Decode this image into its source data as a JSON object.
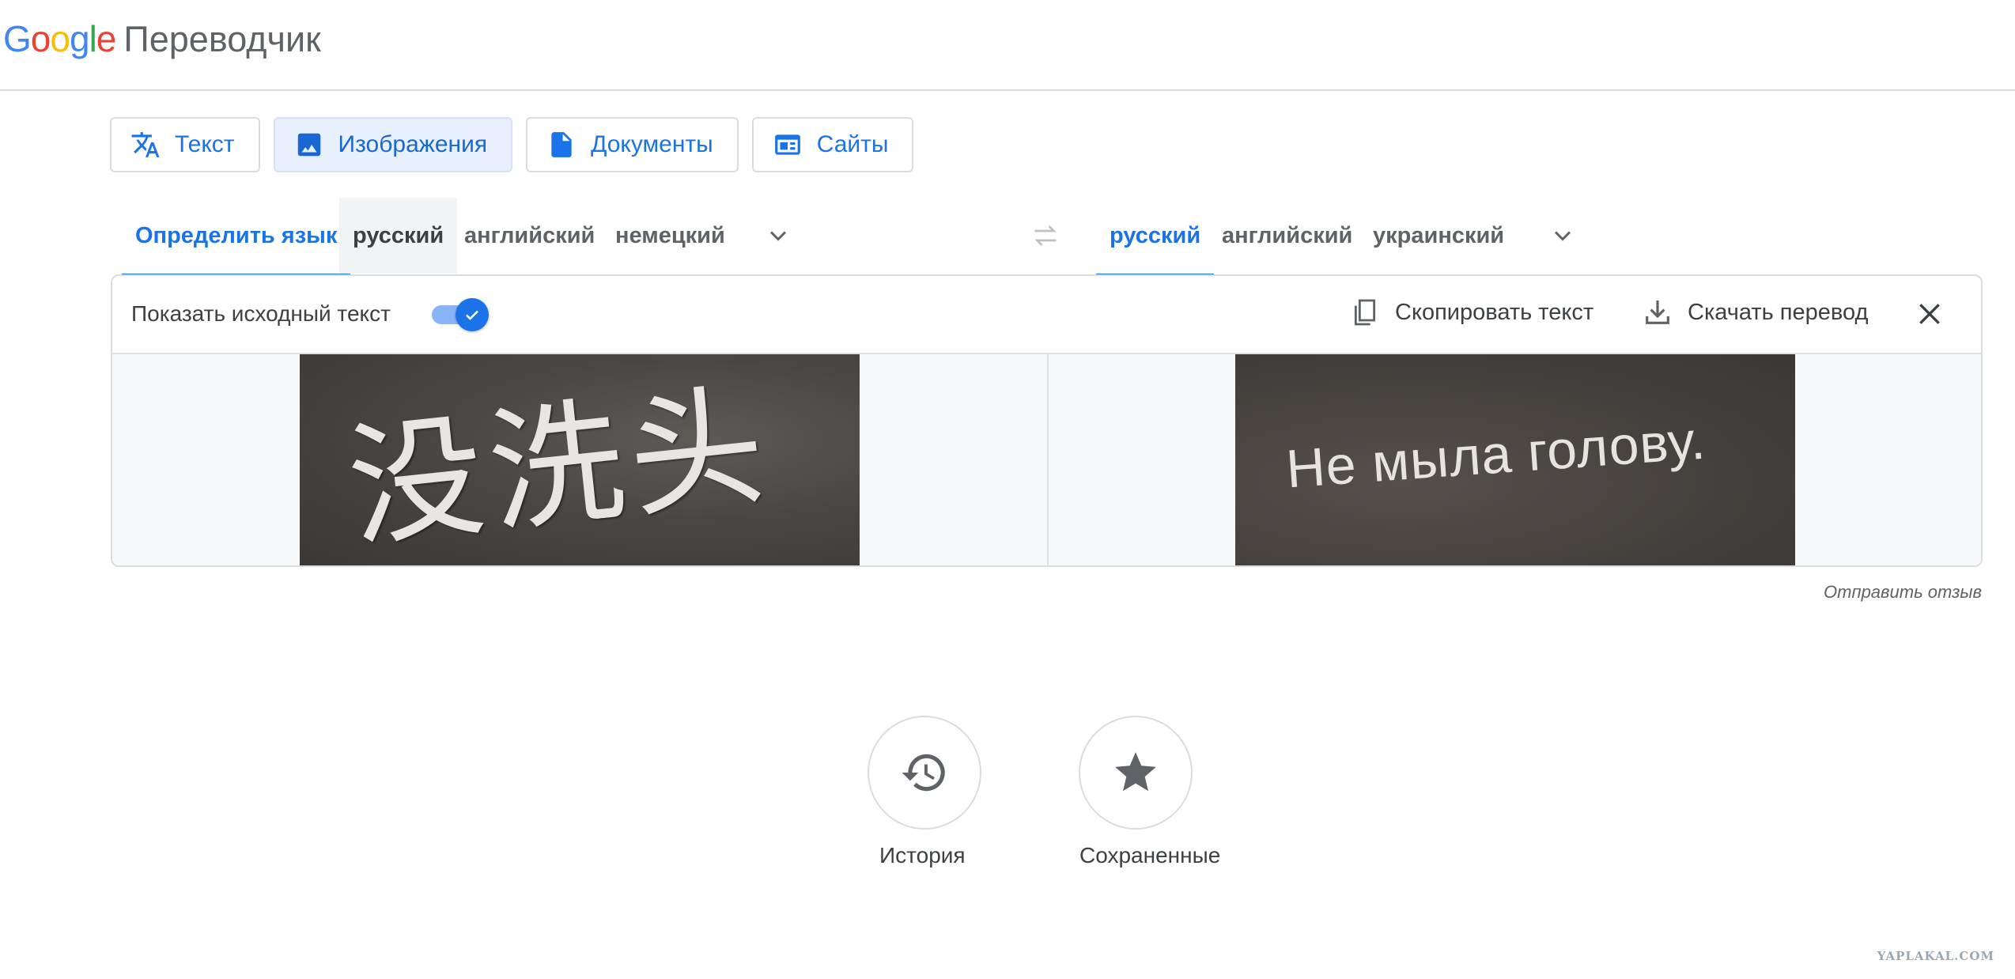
{
  "header": {
    "logo_letters": [
      {
        "char": "G",
        "color": "#4285f4"
      },
      {
        "char": "o",
        "color": "#ea4335"
      },
      {
        "char": "o",
        "color": "#fbbc05"
      },
      {
        "char": "g",
        "color": "#4285f4"
      },
      {
        "char": "l",
        "color": "#34a853"
      },
      {
        "char": "e",
        "color": "#ea4335"
      }
    ],
    "product_name": "Переводчик"
  },
  "mode_tabs": [
    {
      "label": "Текст",
      "icon": "translate-icon",
      "active": false
    },
    {
      "label": "Изображения",
      "icon": "image-icon",
      "active": true
    },
    {
      "label": "Документы",
      "icon": "document-icon",
      "active": false
    },
    {
      "label": "Сайты",
      "icon": "website-icon",
      "active": false
    }
  ],
  "source_languages": {
    "detect": "Определить язык",
    "items": [
      "русский",
      "английский",
      "немецкий"
    ],
    "selected": "Определить язык",
    "hovered": "русский"
  },
  "target_languages": {
    "items": [
      "русский",
      "английский",
      "украинский"
    ],
    "selected": "русский"
  },
  "panel": {
    "show_source_label": "Показать исходный текст",
    "show_source_enabled": true,
    "copy_label": "Скопировать текст",
    "download_label": "Скачать перевод",
    "source_image_text": "没洗头",
    "translated_image_text": "Не мыла голову."
  },
  "feedback_label": "Отправить отзыв",
  "bottom": {
    "history_label": "История",
    "saved_label": "Сохраненные"
  },
  "watermark": "YAPLAKAL.COM",
  "colors": {
    "accent": "#1a73e8",
    "active_tab_bg": "#e8f0fe",
    "border": "#dadce0",
    "text": "#3c4043"
  }
}
